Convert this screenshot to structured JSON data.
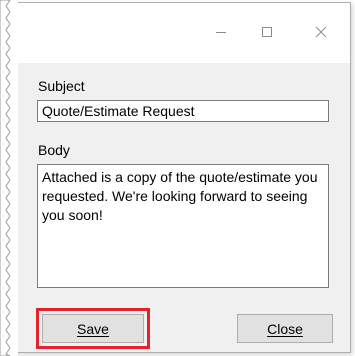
{
  "window": {
    "controls": {
      "minimize_icon": "minimize-icon",
      "maximize_icon": "maximize-icon",
      "close_icon": "close-icon"
    }
  },
  "form": {
    "subject_label": "Subject",
    "subject_value": "Quote/Estimate Request",
    "body_label": "Body",
    "body_value": "Attached is a copy of the quote/estimate you requested. We're looking forward to seeing you soon!"
  },
  "buttons": {
    "save_label": "Save",
    "close_label": "Close",
    "highlight_color": "#e4222b"
  }
}
